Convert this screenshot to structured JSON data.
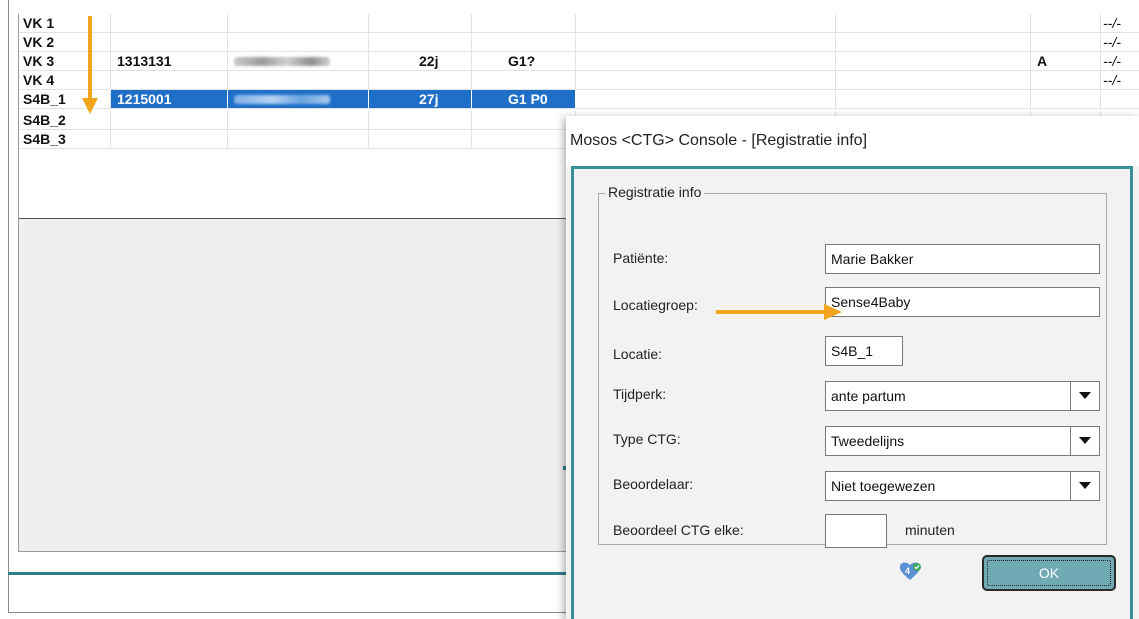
{
  "grid": {
    "rows": [
      {
        "loc": "VK 1",
        "id": "",
        "age": "",
        "gp": "",
        "flag": "",
        "time": "--/-",
        "blurred": false
      },
      {
        "loc": "VK 2",
        "id": "",
        "age": "",
        "gp": "",
        "flag": "",
        "time": "--/-",
        "blurred": false
      },
      {
        "loc": "VK 3",
        "id": "1313131",
        "age": "22j",
        "gp": "G1?",
        "flag": "A",
        "time": "--/-",
        "blurred": true
      },
      {
        "loc": "VK 4",
        "id": "",
        "age": "",
        "gp": "",
        "flag": "",
        "time": "--/-",
        "blurred": false
      },
      {
        "loc": "S4B_1",
        "id": "1215001",
        "age": "27j",
        "gp": "G1 P0",
        "flag": "",
        "time": "",
        "blurred": true
      },
      {
        "loc": "S4B_2",
        "id": "",
        "age": "",
        "gp": "",
        "flag": "",
        "time": "",
        "blurred": false
      },
      {
        "loc": "S4B_3",
        "id": "",
        "age": "",
        "gp": "",
        "flag": "",
        "time": "",
        "blurred": false
      }
    ],
    "selected_row": "S4B_1"
  },
  "dialog": {
    "title": "Mosos <CTG> Console - [Registratie info]",
    "group_title": "Registratie info",
    "fields": {
      "patient_label": "Patiënte:",
      "patient_value": "Marie Bakker",
      "locatiegroep_label": "Locatiegroep:",
      "locatiegroep_value": "Sense4Baby",
      "locatie_label": "Locatie:",
      "locatie_value": "S4B_1",
      "tijdperk_label": "Tijdperk:",
      "tijdperk_value": "ante partum",
      "type_ctg_label": "Type CTG:",
      "type_ctg_value": "Tweedelijns",
      "beoordelaar_label": "Beoordelaar:",
      "beoordelaar_value": "Niet toegewezen",
      "beoordeel_label": "Beoordeel CTG elke:",
      "beoordeel_value": "",
      "minuten_label": "minuten"
    },
    "ok_label": "OK"
  },
  "colors": {
    "selection": "#1f6fc8",
    "dialog_border": "#3a8e9a",
    "annotation_arrow": "#f0a51c",
    "ok_button": "#6faab5"
  },
  "icons": [
    "down-arrow-annotation-icon",
    "right-arrow-annotation-icon",
    "dropdown-arrow-icon",
    "app-logo-icon"
  ]
}
